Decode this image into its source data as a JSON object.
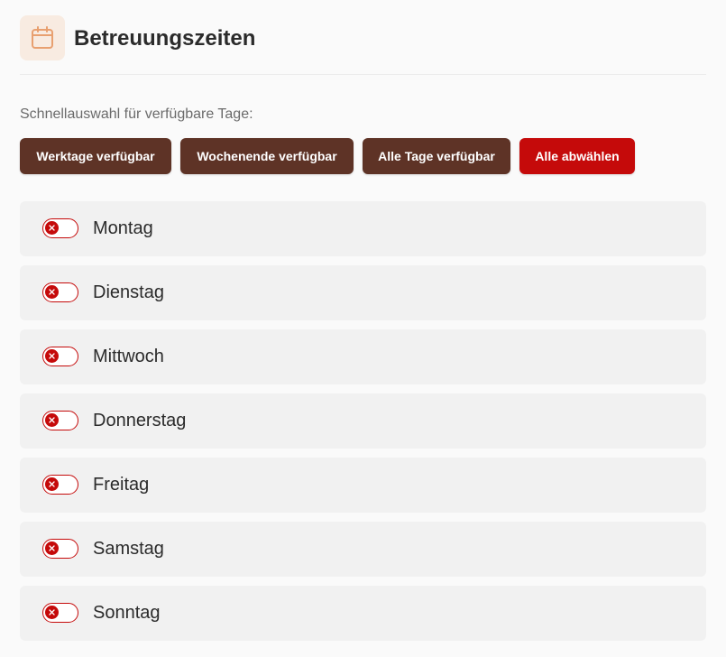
{
  "header": {
    "title": "Betreuungszeiten",
    "icon": "calendar-icon",
    "icon_color": "#e8a070"
  },
  "quick_select": {
    "label": "Schnellauswahl für verfügbare Tage:",
    "buttons": [
      {
        "label": "Werktage verfügbar",
        "color": "#5e3326"
      },
      {
        "label": "Wochenende verfügbar",
        "color": "#5e3326"
      },
      {
        "label": "Alle Tage verfügbar",
        "color": "#5e3326"
      },
      {
        "label": "Alle abwählen",
        "color": "#c50a0a"
      }
    ]
  },
  "days": [
    {
      "label": "Montag",
      "enabled": false
    },
    {
      "label": "Dienstag",
      "enabled": false
    },
    {
      "label": "Mittwoch",
      "enabled": false
    },
    {
      "label": "Donnerstag",
      "enabled": false
    },
    {
      "label": "Freitag",
      "enabled": false
    },
    {
      "label": "Samstag",
      "enabled": false
    },
    {
      "label": "Sonntag",
      "enabled": false
    }
  ],
  "colors": {
    "accent_brown": "#5e3326",
    "accent_red": "#c50a0a",
    "row_background": "#f1f1f1"
  }
}
